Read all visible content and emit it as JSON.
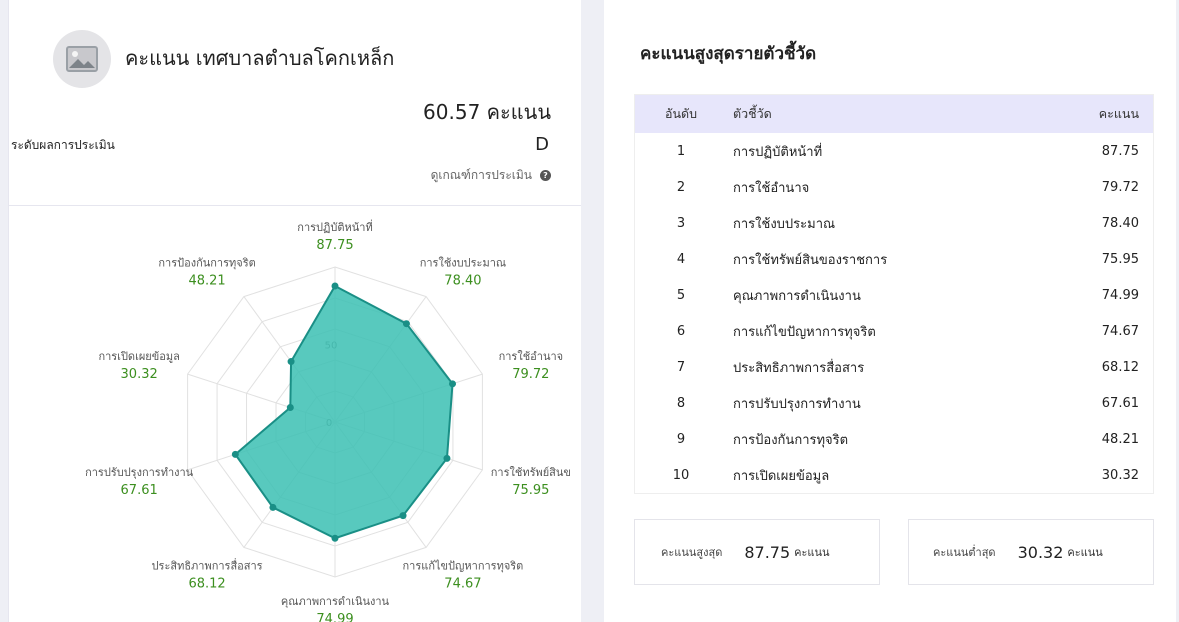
{
  "left": {
    "org_title": "คะแนน เทศบาลตำบลโคกเหล็ก",
    "total_score_text": "60.57 คะแนน",
    "level_label": "ระดับผลการประเมิน",
    "level_value": "D",
    "criteria_link": "ดูเกณฑ์การประเมิน",
    "avatar_icon": "image-placeholder-icon",
    "help_icon": "question-circle-icon"
  },
  "chart_data": {
    "type": "radar",
    "rmax": 100,
    "ring_labels": [
      "0",
      "50"
    ],
    "fill_color": "#3bbfb3",
    "line_color": "#1a8f86",
    "value_color": "#3c8f1f",
    "axes": [
      {
        "label": "การปฏิบัติหน้าที่",
        "value": 87.75,
        "value_text": "87.75"
      },
      {
        "label": "การใช้งบประมาณ",
        "value": 78.4,
        "value_text": "78.40"
      },
      {
        "label": "การใช้อำนาจ",
        "value": 79.72,
        "value_text": "79.72"
      },
      {
        "label": "การใช้ทรัพย์สินข",
        "value": 75.95,
        "value_text": "75.95"
      },
      {
        "label": "การแก้ไขปัญหาการทุจริต",
        "value": 74.67,
        "value_text": "74.67"
      },
      {
        "label": "คุณภาพการดำเนินงาน",
        "value": 74.99,
        "value_text": "74.99"
      },
      {
        "label": "ประสิทธิภาพการสื่อสาร",
        "value": 68.12,
        "value_text": "68.12"
      },
      {
        "label": "การปรับปรุงการทำงาน",
        "value": 67.61,
        "value_text": "67.61"
      },
      {
        "label": "การเปิดเผยข้อมูล",
        "value": 30.32,
        "value_text": "30.32"
      },
      {
        "label": "การป้องกันการทุจริต",
        "value": 48.21,
        "value_text": "48.21"
      }
    ]
  },
  "right": {
    "title": "คะแนนสูงสุดรายตัวชี้วัด",
    "columns": [
      "อันดับ",
      "ตัวชี้วัด",
      "คะแนน"
    ],
    "rows": [
      [
        "1",
        "การปฏิบัติหน้าที่",
        "87.75"
      ],
      [
        "2",
        "การใช้อำนาจ",
        "79.72"
      ],
      [
        "3",
        "การใช้งบประมาณ",
        "78.40"
      ],
      [
        "4",
        "การใช้ทรัพย์สินของราชการ",
        "75.95"
      ],
      [
        "5",
        "คุณภาพการดำเนินงาน",
        "74.99"
      ],
      [
        "6",
        "การแก้ไขปัญหาการทุจริต",
        "74.67"
      ],
      [
        "7",
        "ประสิทธิภาพการสื่อสาร",
        "68.12"
      ],
      [
        "8",
        "การปรับปรุงการทำงาน",
        "67.61"
      ],
      [
        "9",
        "การป้องกันการทุจริต",
        "48.21"
      ],
      [
        "10",
        "การเปิดเผยข้อมูล",
        "30.32"
      ]
    ],
    "max_box": {
      "label": "คะแนนสูงสุด",
      "value": "87.75",
      "unit": "คะแนน"
    },
    "min_box": {
      "label": "คะแนนต่ำสุด",
      "value": "30.32",
      "unit": "คะแนน"
    }
  }
}
